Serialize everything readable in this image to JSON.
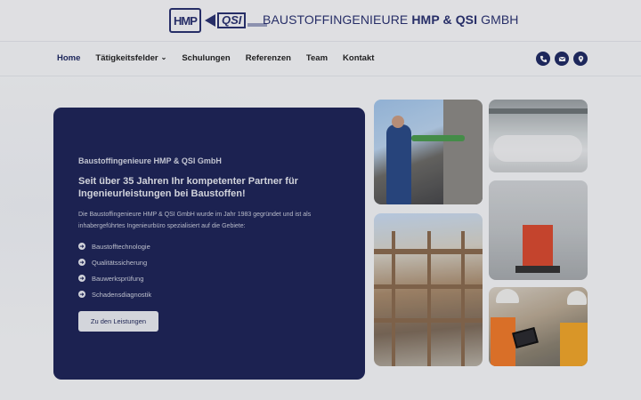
{
  "header": {
    "logo_hmp": "HMP",
    "logo_qsi": "QSI",
    "company_title_regular": "BAUSTOFFINGENIEURE ",
    "company_title_bold": "HMP & QSI",
    "company_title_end": " GMBH"
  },
  "nav": {
    "items": [
      {
        "label": "Home",
        "active": true
      },
      {
        "label": "Tätigkeitsfelder",
        "has_dropdown": true
      },
      {
        "label": "Schulungen"
      },
      {
        "label": "Referenzen"
      },
      {
        "label": "Team"
      },
      {
        "label": "Kontakt"
      }
    ],
    "icons": [
      "phone-icon",
      "mail-icon",
      "location-icon"
    ]
  },
  "hero": {
    "kicker": "Baustoffingenieure HMP & QSI GmbH",
    "headline": "Seit über 35 Jahren Ihr kompetenter Partner für Ingenieurleistungen bei Baustoffen!",
    "intro": "Die Baustoffingenieure HMP & QSI GmbH wurde im Jahr 1983 gegründet und ist als inhabergeführtes Ingenieurbüro spezialisiert auf die Gebiete:",
    "list": [
      "Baustofftechnologie",
      "Qualitätssicherung",
      "Bauwerksprüfung",
      "Schadensdiagnostik"
    ],
    "button_label": "Zu den Leistungen"
  },
  "colors": {
    "brand_navy": "#1d2457",
    "nav_active": "#1f2a63",
    "background": "#f4f5f8"
  }
}
